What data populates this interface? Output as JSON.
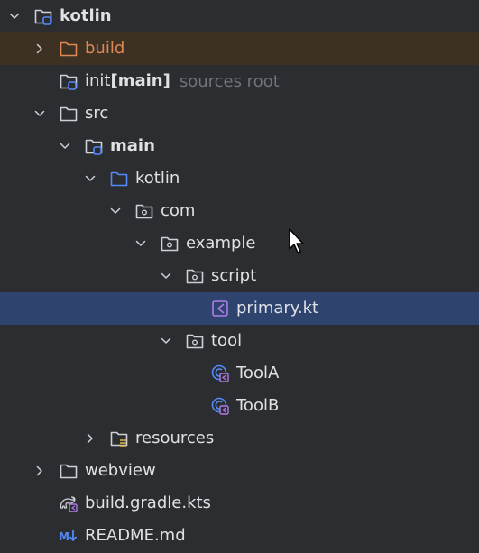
{
  "tree": {
    "items": [
      {
        "label": "kotlin",
        "bold": true,
        "hint": "",
        "icon": "module-folder-icon",
        "chevron": "down",
        "indent": 0
      },
      {
        "label": "build",
        "bold": false,
        "hint": "",
        "icon": "excluded-folder-icon",
        "chevron": "right",
        "indent": 1,
        "highlight": "build"
      },
      {
        "label": "init ",
        "bold_part": "[main]",
        "bold": false,
        "hint": "sources root",
        "icon": "module-folder-icon",
        "chevron": "none",
        "indent": 1
      },
      {
        "label": "src",
        "bold": false,
        "hint": "",
        "icon": "folder-icon",
        "chevron": "down",
        "indent": 1
      },
      {
        "label": "main",
        "bold": true,
        "hint": "",
        "icon": "module-folder-icon",
        "chevron": "down",
        "indent": 2
      },
      {
        "label": "kotlin",
        "bold": false,
        "hint": "",
        "icon": "source-folder-icon",
        "chevron": "down",
        "indent": 3
      },
      {
        "label": "com",
        "bold": false,
        "hint": "",
        "icon": "package-icon",
        "chevron": "down",
        "indent": 4
      },
      {
        "label": "example",
        "bold": false,
        "hint": "",
        "icon": "package-icon",
        "chevron": "down",
        "indent": 5
      },
      {
        "label": "script",
        "bold": false,
        "hint": "",
        "icon": "package-icon",
        "chevron": "down",
        "indent": 6
      },
      {
        "label": "primary.kt",
        "bold": false,
        "hint": "",
        "icon": "kotlin-file-icon",
        "chevron": "none",
        "indent": 7,
        "highlight": "selected"
      },
      {
        "label": "tool",
        "bold": false,
        "hint": "",
        "icon": "package-icon",
        "chevron": "down",
        "indent": 6
      },
      {
        "label": "ToolA",
        "bold": false,
        "hint": "",
        "icon": "kotlin-class-icon",
        "chevron": "none",
        "indent": 7
      },
      {
        "label": "ToolB",
        "bold": false,
        "hint": "",
        "icon": "kotlin-class-icon",
        "chevron": "none",
        "indent": 7
      },
      {
        "label": "resources",
        "bold": false,
        "hint": "",
        "icon": "resources-folder-icon",
        "chevron": "right",
        "indent": 3
      },
      {
        "label": "webview",
        "bold": false,
        "hint": "",
        "icon": "folder-icon",
        "chevron": "right",
        "indent": 1
      },
      {
        "label": "build.gradle.kts",
        "bold": false,
        "hint": "",
        "icon": "gradle-kotlin-icon",
        "chevron": "none",
        "indent": 1
      },
      {
        "label": "README.md",
        "bold": false,
        "hint": "",
        "icon": "markdown-icon",
        "chevron": "none",
        "indent": 1
      }
    ]
  },
  "colors": {
    "background": "#2b2d30",
    "selection": "#2e436e",
    "excluded_row": "#3c3122",
    "excluded_text": "#e08855",
    "hint_text": "#6f737a"
  }
}
